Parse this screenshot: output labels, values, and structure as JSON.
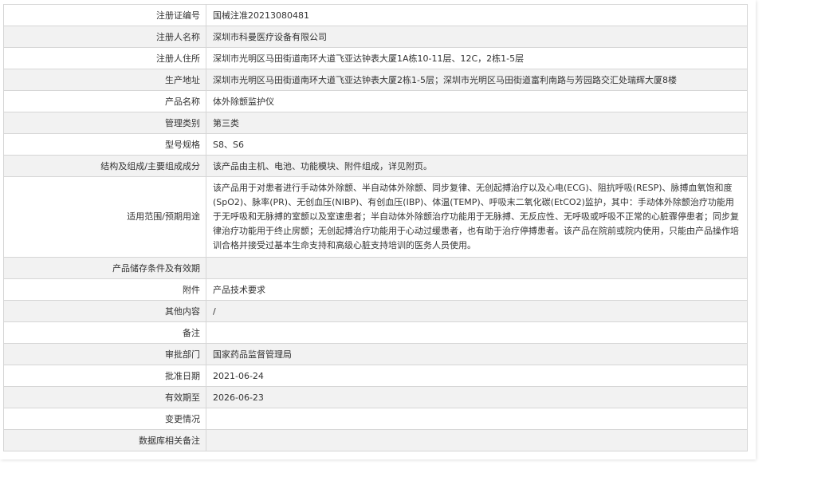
{
  "rows": [
    {
      "label": "注册证编号",
      "value": "国械注准20213080481"
    },
    {
      "label": "注册人名称",
      "value": "深圳市科曼医疗设备有限公司"
    },
    {
      "label": "注册人住所",
      "value": "深圳市光明区马田街道南环大道飞亚达钟表大厦1A栋10-11层、12C，2栋1-5层"
    },
    {
      "label": "生产地址",
      "value": "深圳市光明区马田街道南环大道飞亚达钟表大厦2栋1-5层；深圳市光明区马田街道富利南路与芳园路交汇处瑞辉大厦8楼"
    },
    {
      "label": "产品名称",
      "value": "体外除颤监护仪"
    },
    {
      "label": "管理类别",
      "value": "第三类"
    },
    {
      "label": "型号规格",
      "value": "S8、S6"
    },
    {
      "label": "结构及组成/主要组成成分",
      "value": "该产品由主机、电池、功能模块、附件组成，详见附页。"
    },
    {
      "label": "适用范围/预期用途",
      "value": "该产品用于对患者进行手动体外除颤、半自动体外除颤、同步复律、无创起搏治疗以及心电(ECG)、阻抗呼吸(RESP)、脉搏血氧饱和度(SpO2)、脉率(PR)、无创血压(NIBP)、有创血压(IBP)、体温(TEMP)、呼吸末二氧化碳(EtCO2)监护，其中：手动体外除颤治疗功能用于无呼吸和无脉搏的室颤以及室速患者；半自动体外除颤治疗功能用于无脉搏、无反应性、无呼吸或呼吸不正常的心脏骤停患者；同步复律治疗功能用于终止房颤；无创起搏治疗功能用于心动过缓患者，也有助于治疗停搏患者。该产品在院前或院内使用，只能由产品操作培训合格并接受过基本生命支持和高级心脏支持培训的医务人员使用。"
    },
    {
      "label": "产品储存条件及有效期",
      "value": ""
    },
    {
      "label": "附件",
      "value": "产品技术要求"
    },
    {
      "label": "其他内容",
      "value": "/"
    },
    {
      "label": "备注",
      "value": ""
    },
    {
      "label": "审批部门",
      "value": "国家药品监督管理局"
    },
    {
      "label": "批准日期",
      "value": "2021-06-24"
    },
    {
      "label": "有效期至",
      "value": "2026-06-23"
    },
    {
      "label": "变更情况",
      "value": ""
    },
    {
      "label": "数据库相关备注",
      "value": ""
    }
  ]
}
